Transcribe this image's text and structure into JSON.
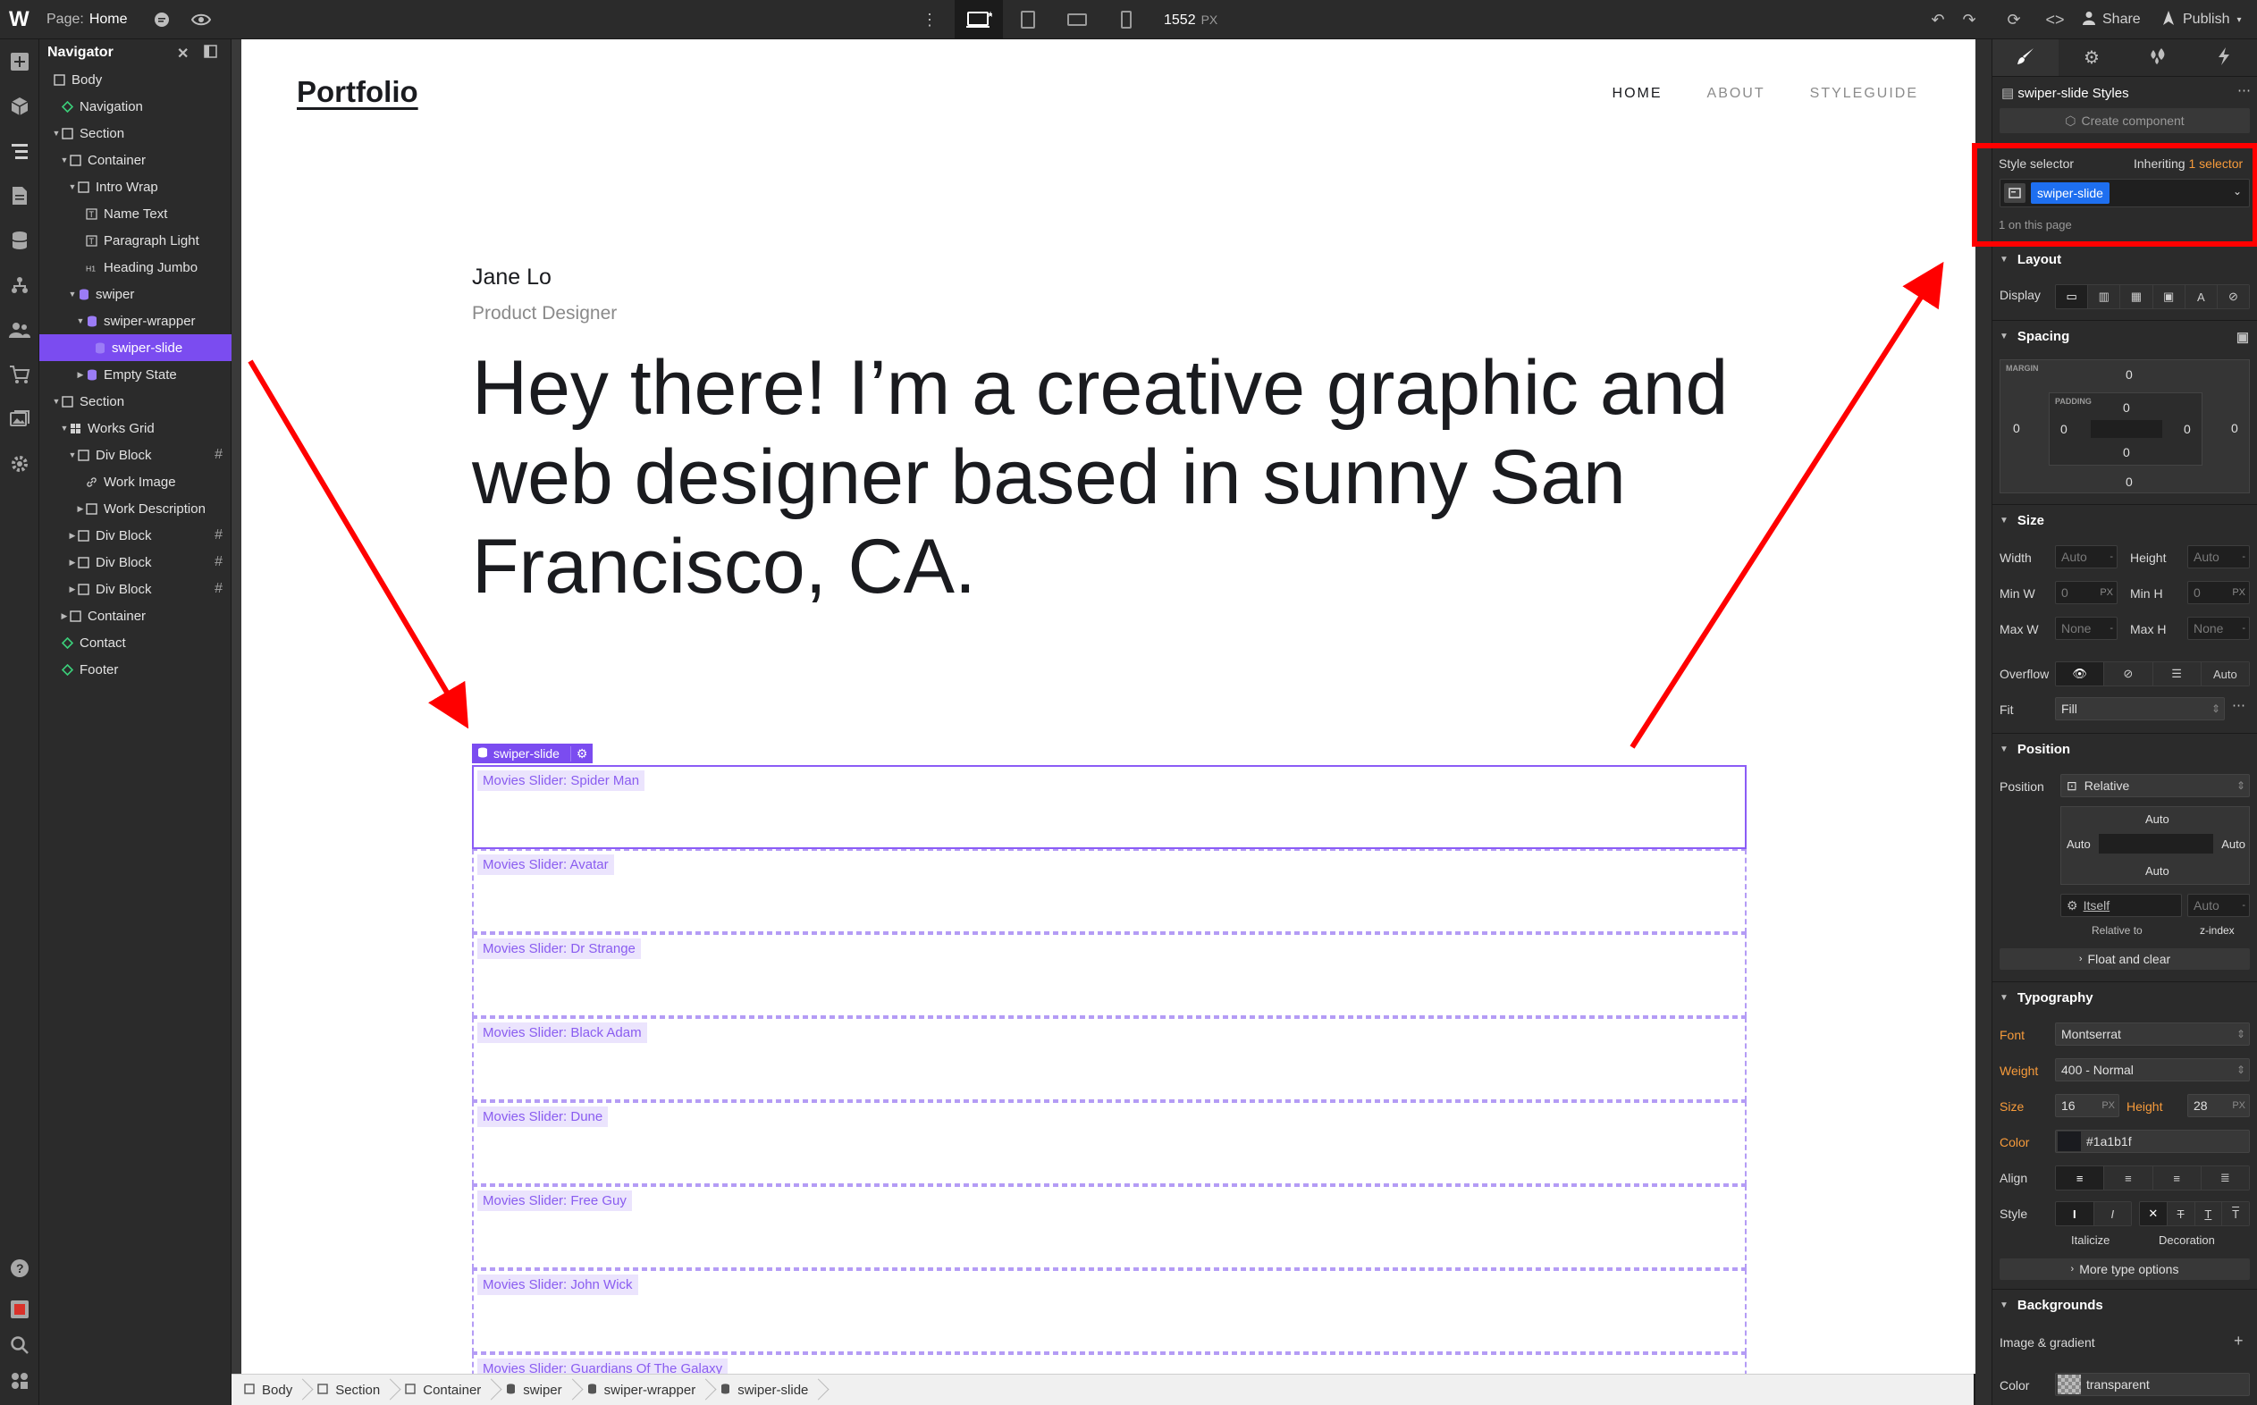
{
  "topbar": {
    "page_prefix": "Page:",
    "page_name": "Home",
    "canvas_width": "1552",
    "canvas_unit": "PX",
    "share_label": "Share",
    "publish_label": "Publish"
  },
  "navigator": {
    "title": "Navigator",
    "items": [
      {
        "label": "Body",
        "depth": 0,
        "icon": "box",
        "caret": ""
      },
      {
        "label": "Navigation",
        "depth": 1,
        "icon": "component",
        "caret": ""
      },
      {
        "label": "Section",
        "depth": 1,
        "icon": "box",
        "caret": "down"
      },
      {
        "label": "Container",
        "depth": 2,
        "icon": "box",
        "caret": "down"
      },
      {
        "label": "Intro Wrap",
        "depth": 3,
        "icon": "box",
        "caret": "down"
      },
      {
        "label": "Name Text",
        "depth": 4,
        "icon": "text",
        "caret": ""
      },
      {
        "label": "Paragraph Light",
        "depth": 4,
        "icon": "text",
        "caret": ""
      },
      {
        "label": "Heading Jumbo",
        "depth": 4,
        "icon": "heading",
        "caret": ""
      },
      {
        "label": "swiper",
        "depth": 3,
        "icon": "cms",
        "caret": "down"
      },
      {
        "label": "swiper-wrapper",
        "depth": 4,
        "icon": "cms",
        "caret": "down"
      },
      {
        "label": "swiper-slide",
        "depth": 5,
        "icon": "cms",
        "caret": "",
        "selected": true
      },
      {
        "label": "Empty State",
        "depth": 4,
        "icon": "cms",
        "caret": "right"
      },
      {
        "label": "Section",
        "depth": 1,
        "icon": "box",
        "caret": "down"
      },
      {
        "label": "Works Grid",
        "depth": 2,
        "icon": "grid",
        "caret": "down"
      },
      {
        "label": "Div Block",
        "depth": 3,
        "icon": "box",
        "caret": "down",
        "grid": true
      },
      {
        "label": "Work Image",
        "depth": 4,
        "icon": "link",
        "caret": ""
      },
      {
        "label": "Work Description",
        "depth": 4,
        "icon": "box",
        "caret": "right"
      },
      {
        "label": "Div Block",
        "depth": 3,
        "icon": "box",
        "caret": "right",
        "grid": true
      },
      {
        "label": "Div Block",
        "depth": 3,
        "icon": "box",
        "caret": "right",
        "grid": true
      },
      {
        "label": "Div Block",
        "depth": 3,
        "icon": "box",
        "caret": "right",
        "grid": true
      },
      {
        "label": "Container",
        "depth": 2,
        "icon": "box",
        "caret": "right"
      },
      {
        "label": "Contact",
        "depth": 1,
        "icon": "component",
        "caret": ""
      },
      {
        "label": "Footer",
        "depth": 1,
        "icon": "component",
        "caret": ""
      }
    ]
  },
  "site": {
    "brand": "Portfolio",
    "nav": [
      "HOME",
      "ABOUT",
      "STYLEGUIDE"
    ],
    "name_text": "Jane Lo",
    "role_text": "Product Designer",
    "hero": "Hey there! I’m a creative graphic and web designer based in sunny San Francisco, CA.",
    "badge_label": "swiper-slide",
    "slides": [
      "Movies Slider: Spider Man",
      "Movies Slider: Avatar",
      "Movies Slider: Dr Strange",
      "Movies Slider: Black Adam",
      "Movies Slider: Dune",
      "Movies Slider: Free Guy",
      "Movies Slider: John Wick",
      "Movies Slider: Guardians Of The Galaxy"
    ]
  },
  "breadcrumb": [
    "Body",
    "Section",
    "Container",
    "swiper",
    "swiper-wrapper",
    "swiper-slide"
  ],
  "panel": {
    "styles_title": "swiper-slide Styles",
    "create_component": "Create component",
    "style_selector_label": "Style selector",
    "inheriting_prefix": "Inheriting",
    "inheriting_link": "1 selector",
    "selector_chip": "swiper-slide",
    "on_page": "1 on this page",
    "layout": {
      "title": "Layout",
      "display_label": "Display"
    },
    "spacing": {
      "title": "Spacing",
      "margin_label": "MARGIN",
      "padding_label": "PADDING",
      "margin": {
        "top": "0",
        "right": "0",
        "bottom": "0",
        "left": "0"
      },
      "padding": {
        "top": "0",
        "right": "0",
        "bottom": "0",
        "left": "0"
      }
    },
    "size": {
      "title": "Size",
      "width_label": "Width",
      "width_value": "Auto",
      "height_label": "Height",
      "height_value": "Auto",
      "minw_label": "Min W",
      "minw_value": "0",
      "minw_unit": "PX",
      "minh_label": "Min H",
      "minh_value": "0",
      "minh_unit": "PX",
      "maxw_label": "Max W",
      "maxw_value": "None",
      "maxh_label": "Max H",
      "maxh_value": "None",
      "overflow_label": "Overflow",
      "overflow_auto": "Auto",
      "fit_label": "Fit",
      "fit_value": "Fill"
    },
    "position": {
      "title": "Position",
      "label": "Position",
      "value": "Relative",
      "top": "Auto",
      "left": "Auto",
      "right": "Auto",
      "bottom": "Auto",
      "relative_value": "Itself",
      "zindex_value": "Auto",
      "relative_caption": "Relative to",
      "zindex_caption": "z-index",
      "float_label": "Float and clear"
    },
    "typography": {
      "title": "Typography",
      "font_label": "Font",
      "font_value": "Montserrat",
      "weight_label": "Weight",
      "weight_value": "400 - Normal",
      "size_label": "Size",
      "size_value": "16",
      "size_unit": "PX",
      "height_label": "Height",
      "height_value": "28",
      "height_unit": "PX",
      "color_label": "Color",
      "color_value": "#1a1b1f",
      "align_label": "Align",
      "style_label": "Style",
      "italicize_caption": "Italicize",
      "decoration_caption": "Decoration",
      "more_label": "More type options"
    },
    "backgrounds": {
      "title": "Backgrounds",
      "image_label": "Image & gradient",
      "color_label": "Color",
      "color_value": "transparent"
    }
  },
  "colors": {
    "accent": "#7b4cf0",
    "selector_chip": "#1e6ff0",
    "annotation": "#ff0000",
    "label_orange": "#f79b3b"
  }
}
